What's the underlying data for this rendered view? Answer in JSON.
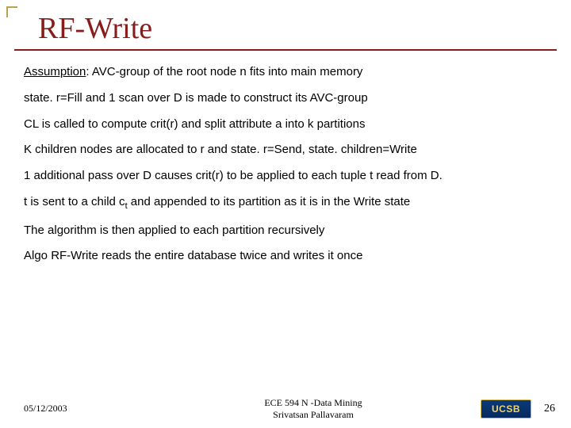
{
  "title": "RF-Write",
  "paragraphs": {
    "p1_lead": "Assumption",
    "p1_rest": ": AVC-group of the root node n fits into main memory",
    "p2": "state. r=Fill and 1 scan over D is made to construct its AVC-group",
    "p3": "CL is called to compute crit(r) and split attribute a into k partitions",
    "p4": "K children nodes are allocated to r and state. r=Send, state. children=Write",
    "p5": "1 additional pass over D causes crit(r) to be applied to each tuple t read from D.",
    "p6_a": "t is sent to a child c",
    "p6_sub": "t",
    "p6_b": " and appended to its partition as it is in the Write state",
    "p7": "The algorithm is then applied to each partition recursively",
    "p8": "Algo RF-Write reads the entire database twice and writes it once"
  },
  "footer": {
    "date": "05/12/2003",
    "course_line1": "ECE 594 N -Data Mining",
    "course_line2": "Srivatsan Pallavaram",
    "logo_text": "UCSB",
    "page_number": "26"
  }
}
